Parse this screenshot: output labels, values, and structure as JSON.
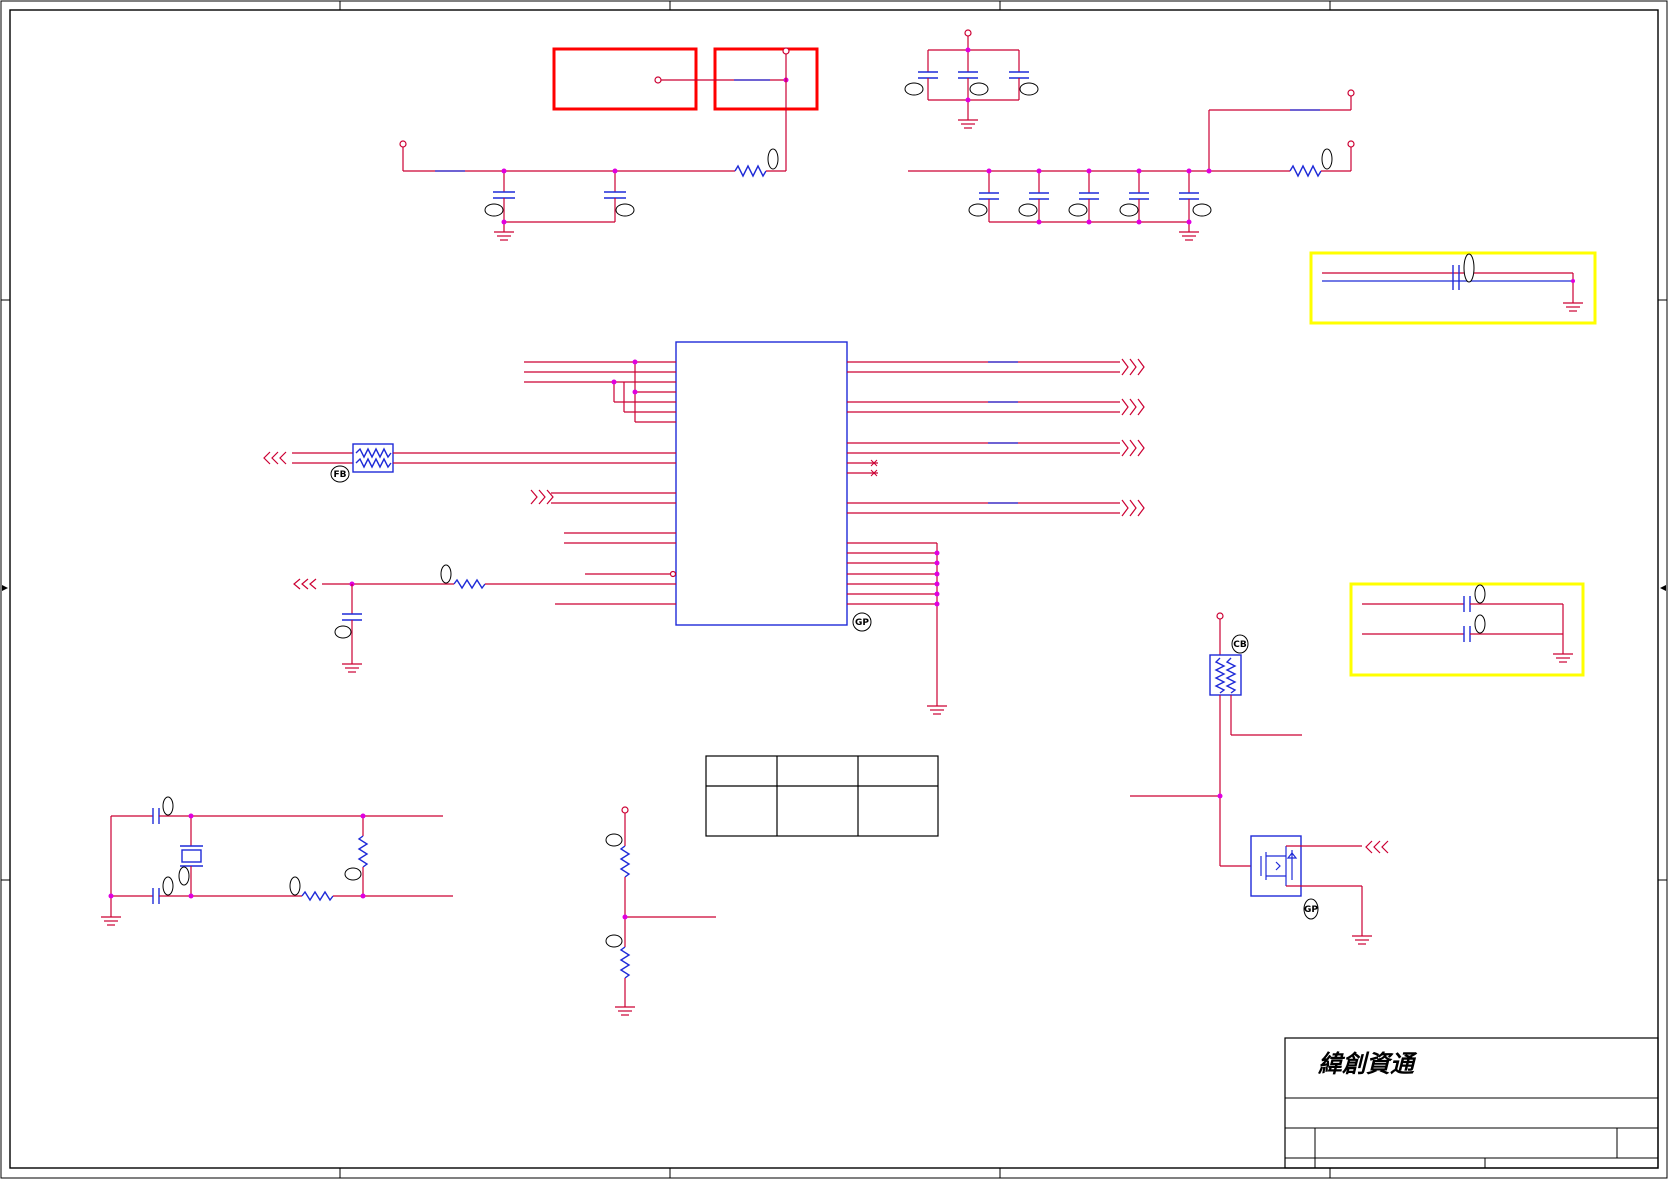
{
  "title_block": {
    "company_name": "緯創資通"
  },
  "part_bubbles": {
    "ferrite_bead": "FB",
    "main_ic": "GP",
    "mosfet": "GP",
    "bead_upper": "CB",
    "generic": "C"
  },
  "colors": {
    "wire": "#cc0033",
    "component": "#1f2bd8",
    "junction": "#e000e0",
    "highlight_red": "#ff0000",
    "highlight_yellow": "#ffff00",
    "frame": "#000000"
  }
}
